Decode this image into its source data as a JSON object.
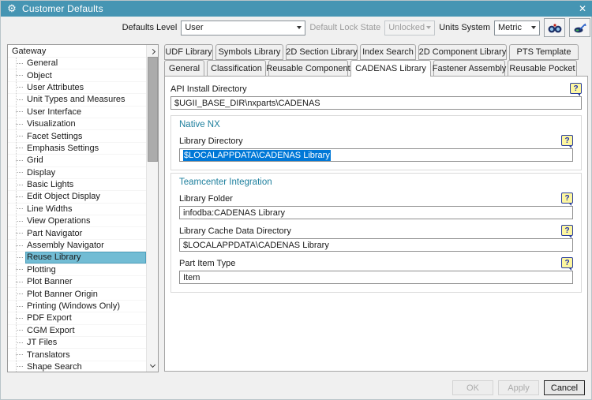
{
  "title_bar": {
    "title": "Customer Defaults",
    "close_glyph": "✕",
    "gear_glyph": "⚙"
  },
  "toolbar": {
    "defaults_level_label": "Defaults Level",
    "defaults_level_value": "User",
    "lock_state_label": "Default Lock State",
    "lock_state_value": "Unlocked",
    "units_label": "Units System",
    "units_value": "Metric"
  },
  "sidebar": {
    "root": "Gateway",
    "selected": "Reuse Library",
    "items": [
      "General",
      "Object",
      "User Attributes",
      "Unit Types and Measures",
      "User Interface",
      "Visualization",
      "Facet Settings",
      "Emphasis Settings",
      "Grid",
      "Display",
      "Basic Lights",
      "Edit Object Display",
      "Line Widths",
      "View Operations",
      "Part Navigator",
      "Assembly Navigator",
      "Reuse Library",
      "Plotting",
      "Plot Banner",
      "Plot Banner Origin",
      "Printing (Windows Only)",
      "PDF Export",
      "CGM Export",
      "JT Files",
      "Translators",
      "Shape Search"
    ]
  },
  "tabs": {
    "row1": [
      "UDF Library",
      "Symbols Library",
      "2D Section Library",
      "Index Search",
      "2D Component Library",
      "PTS Template"
    ],
    "row2": [
      "General",
      "Classification",
      "Reusable Component",
      "CADENAS Library",
      "Fastener Assembly",
      "Reusable Pocket"
    ],
    "active": "CADENAS Library"
  },
  "content": {
    "api_install": {
      "label": "API Install Directory",
      "value": "$UGII_BASE_DIR\\nxparts\\CADENAS"
    },
    "native_nx": {
      "heading": "Native NX",
      "library_directory": {
        "label": "Library Directory",
        "value": "$LOCALAPPDATA\\CADENAS Library",
        "text_selected": true
      }
    },
    "teamcenter": {
      "heading": "Teamcenter Integration",
      "library_folder": {
        "label": "Library Folder",
        "value": "infodba:CADENAS Library"
      },
      "library_cache": {
        "label": "Library Cache Data Directory",
        "value": "$LOCALAPPDATA\\CADENAS Library"
      },
      "part_item_type": {
        "label": "Part Item Type",
        "value": "Item"
      }
    },
    "help_glyph": "?"
  },
  "footer": {
    "ok_label": "OK",
    "apply_label": "Apply",
    "cancel_label": "Cancel"
  },
  "colors": {
    "titlebar": "#4695b3",
    "selection_blue": "#0078d7",
    "sidebar_selected": "#72bcd4",
    "group_heading_teal": "#1d7f9d",
    "help_icon_yellow": "#fdf6a0",
    "help_icon_blue": "#2b3f9c"
  }
}
